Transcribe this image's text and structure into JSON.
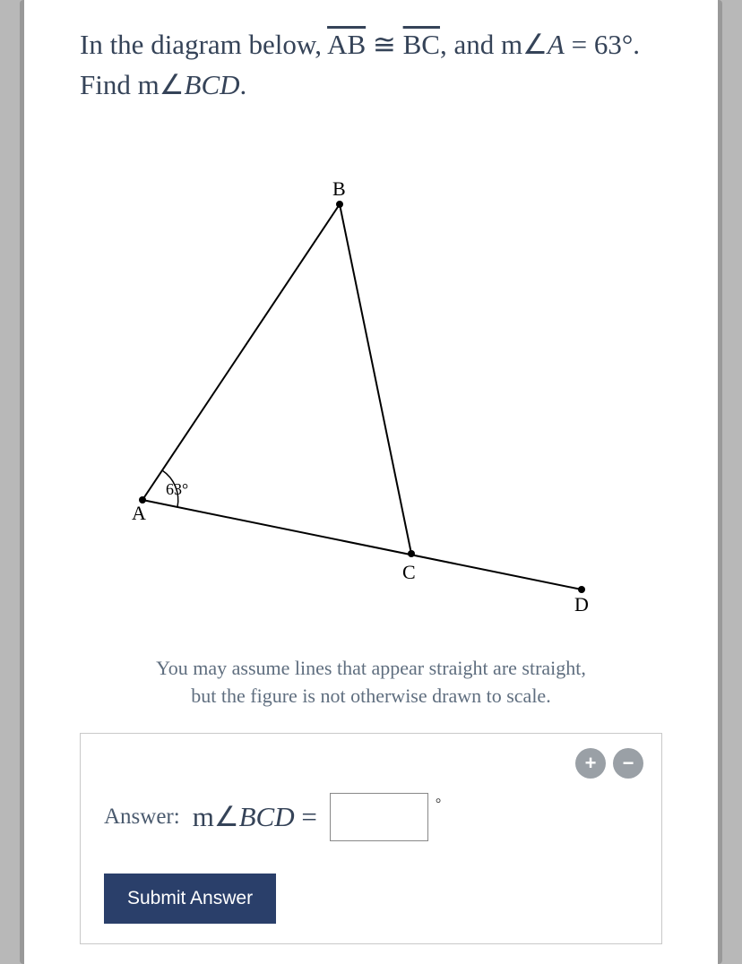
{
  "question": {
    "pre": "In the diagram below, ",
    "seg1": "AB",
    "cong": " ≅ ",
    "seg2": "BC",
    "post1": ", and m∠",
    "ang1": "A",
    "eq": " = 63°. Find m∠",
    "ang2": "BCD",
    "end": "."
  },
  "diagram": {
    "labels": {
      "A": "A",
      "B": "B",
      "C": "C",
      "D": "D"
    },
    "angle_at_A": "63°"
  },
  "note_line1": "You may assume lines that appear straight are straight,",
  "note_line2": "but the figure is not otherwise drawn to scale.",
  "answer": {
    "label": "Answer:",
    "expr_pre": "m∠",
    "expr_ang": "BCD",
    "expr_post": " =",
    "value": "",
    "degree": "°"
  },
  "controls": {
    "zoom_in": "+",
    "zoom_out": "−"
  },
  "submit_label": "Submit Answer"
}
